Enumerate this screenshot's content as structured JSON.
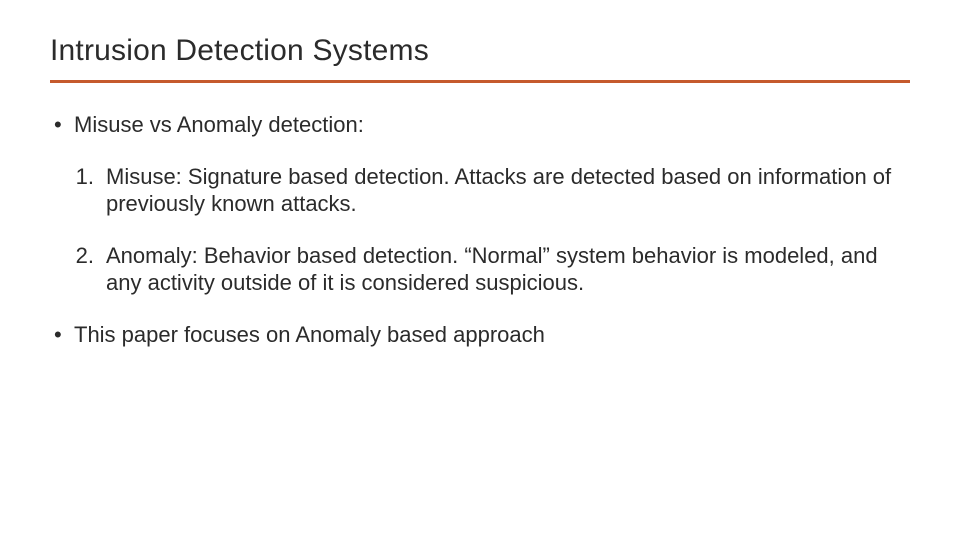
{
  "title": "Intrusion Detection Systems",
  "bullets": {
    "b1": "Misuse vs Anomaly detection:",
    "n1_num": "1.",
    "n1_text": "Misuse: Signature based detection. Attacks are detected based on information of previously known attacks.",
    "n2_num": "2.",
    "n2_text": "Anomaly: Behavior based detection. “Normal” system behavior is modeled, and any activity outside of it is considered suspicious.",
    "b2": "This paper focuses on Anomaly based approach"
  },
  "colors": {
    "accent": "#c55a2d"
  }
}
